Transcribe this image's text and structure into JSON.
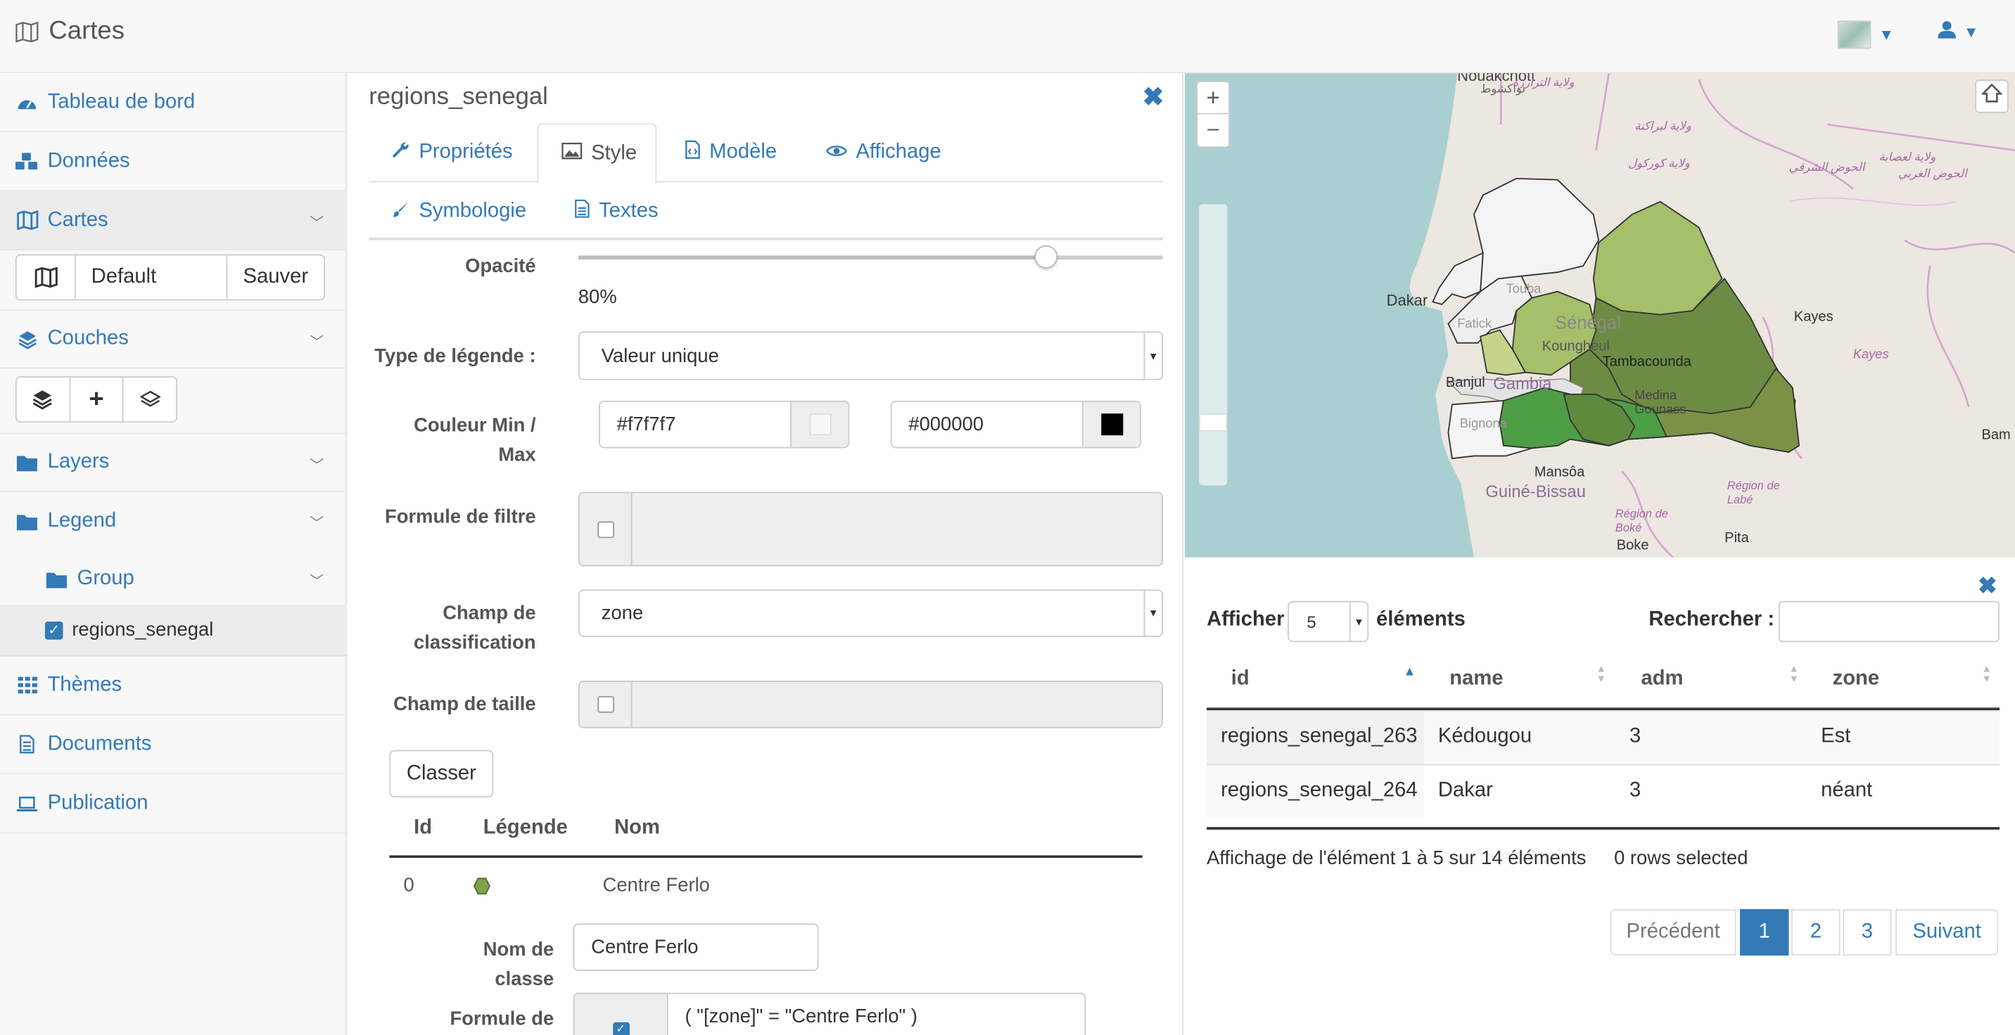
{
  "app": {
    "title": "Cartes"
  },
  "nav": {
    "tableau": "Tableau de bord",
    "donnees": "Données",
    "cartes": "Cartes",
    "map_selected": "Default",
    "save": "Sauver",
    "couches": "Couches",
    "layers": "Layers",
    "legend": "Legend",
    "group": "Group",
    "layer_item": "regions_senegal",
    "themes": "Thèmes",
    "documents": "Documents",
    "publication": "Publication"
  },
  "panel": {
    "title": "regions_senegal",
    "tabs": [
      "Propriétés",
      "Style",
      "Modèle",
      "Affichage"
    ],
    "subtabs": [
      "Symbologie",
      "Textes"
    ],
    "opacity_label": "Opacité",
    "opacity_value": "80%",
    "opacity": 0.8,
    "legend_type_label": "Type de légende :",
    "legend_type": "Valeur unique",
    "color_label_1": "Couleur Min /",
    "color_label_2": "Max",
    "color_min": "#f7f7f7",
    "color_max": "#000000",
    "filter_label": "Formule de filtre",
    "class_field_label_1": "Champ de",
    "class_field_label_2": "classification",
    "class_field": "zone",
    "size_field_label": "Champ de taille",
    "classify_btn": "Classer",
    "table_headers": [
      "Id",
      "Légende",
      "Nom"
    ],
    "class_row": {
      "id": "0",
      "name": "Centre Ferlo",
      "color": "#7ea24a"
    },
    "class_name_label_1": "Nom de",
    "class_name_label_2": "classe",
    "class_name_value": "Centre Ferlo",
    "formula_label": "Formule de",
    "formula_value": "( \"[zone]\" = \"Centre Ferlo\"  )"
  },
  "map": {
    "zoom_in": "+",
    "zoom_out": "–",
    "labels": {
      "nouakchott": "Nouakchott",
      "nouakchott_ar": "نواكشوط",
      "dakar": "Dakar",
      "senegal": "Sénégal",
      "kayes": "Kayes",
      "kayes2": "Kayes",
      "banjul": "Banjul",
      "gambia": "Gambia",
      "mansoa": "Mansôa",
      "guinebissau": "Guiné-Bissau",
      "boke": "Boke",
      "pita": "Pita",
      "bam": "Bam",
      "labe": "Région de Labé",
      "bokereg": "Région de Boké",
      "tamba": "Tambacounda",
      "koungheul": "Koungheul",
      "medina": "Medina Gounass",
      "bignona": "Bignona",
      "fatick": "Fatick",
      "touba": "Touba",
      "ar1": "ولاية الترارزة",
      "ar2": "ولاية لبراكنة",
      "ar3": "ولاية كوركول",
      "ar4": "الحوض الشرقي",
      "ar5": "الحوض الغربي",
      "ar6": "ولاية لعصابة"
    }
  },
  "grid": {
    "show_label": "Afficher",
    "show_value": "5",
    "show_suffix": "éléments",
    "search_label": "Rechercher :",
    "headers": [
      "id",
      "name",
      "adm",
      "zone"
    ],
    "rows": [
      [
        "regions_senegal_263",
        "Kédougou",
        "3",
        "Est"
      ],
      [
        "regions_senegal_264",
        "Dakar",
        "3",
        "néant"
      ]
    ],
    "info": "Affichage de l'élément 1 à 5 sur 14 éléments",
    "selected": "0 rows selected",
    "prev": "Précédent",
    "pages": [
      "1",
      "2",
      "3"
    ],
    "next": "Suivant"
  },
  "colors": {
    "accent": "#337ab7",
    "active_page": "#337ab7"
  }
}
